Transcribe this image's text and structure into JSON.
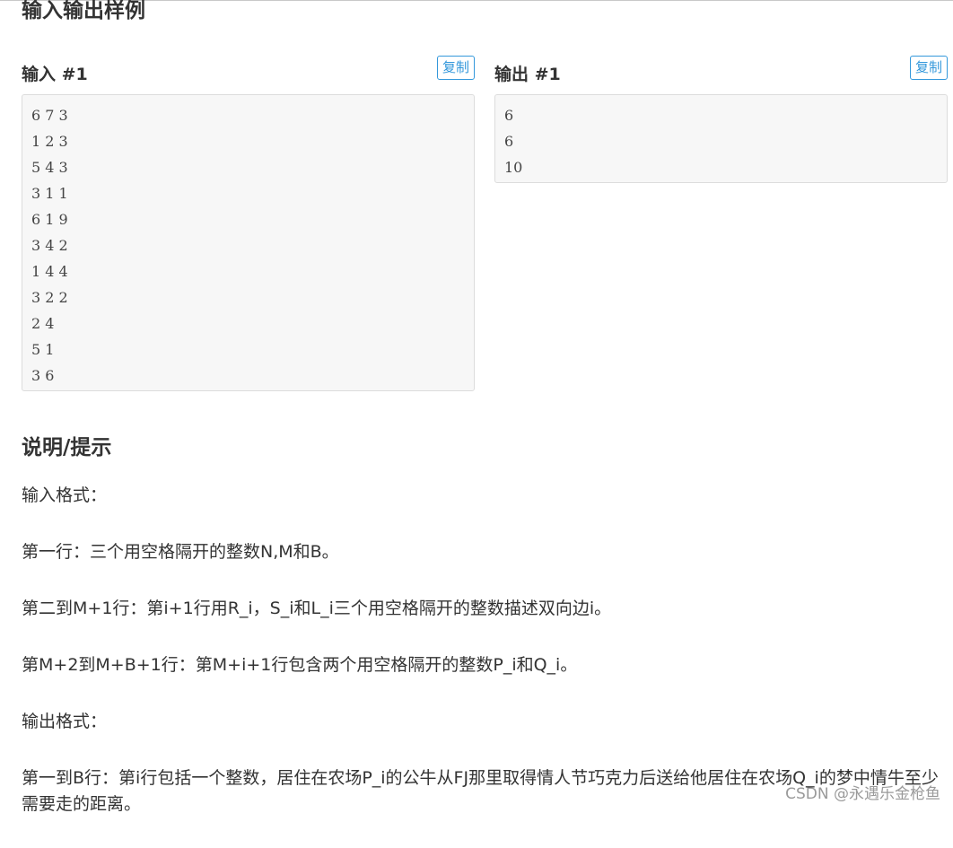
{
  "samples_title": "输入输出样例",
  "input": {
    "label": "输入 #1",
    "copy_label": "复制",
    "lines": [
      "6 7 3",
      "1 2 3",
      "5 4 3",
      "3 1 1",
      "6 1 9",
      "3 4 2",
      "1 4 4",
      "3 2 2",
      "2 4",
      "5 1",
      "3 6"
    ]
  },
  "output": {
    "label": "输出 #1",
    "copy_label": "复制",
    "lines": [
      "6",
      "6",
      "10"
    ]
  },
  "hint": {
    "title": "说明/提示",
    "paragraphs": [
      "输入格式：",
      "第一行：三个用空格隔开的整数N,M和B。",
      "第二到M+1行：第i+1行用R_i，S_i和L_i三个用空格隔开的整数描述双向边i。",
      "第M+2到M+B+1行：第M+i+1行包含两个用空格隔开的整数P_i和Q_i。",
      "输出格式：",
      "第一到B行：第i行包括一个整数，居住在农场P_i的公牛从FJ那里取得情人节巧克力后送给他居住在农场Q_i的梦中情牛至少需要走的距离。"
    ]
  },
  "watermark": "CSDN @永遇乐金枪鱼",
  "colors": {
    "accent": "#3498db",
    "code_bg": "#f7f7f7",
    "text": "#333333"
  }
}
